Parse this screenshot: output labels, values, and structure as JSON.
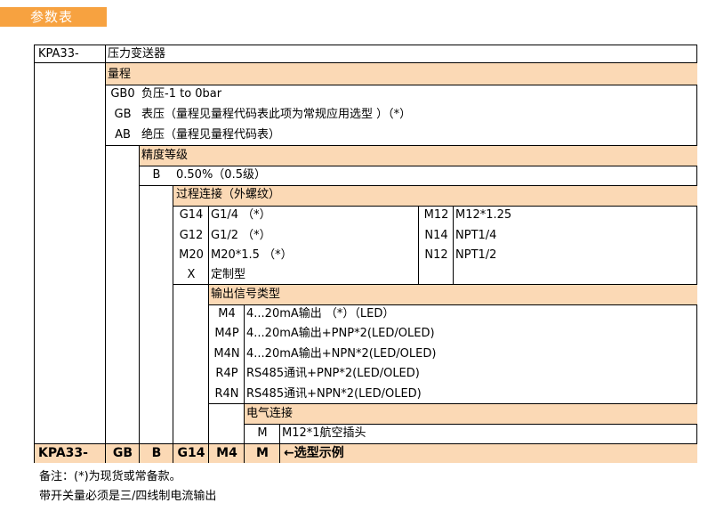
{
  "header": {
    "title": "参数表"
  },
  "table": {
    "model": "KPA33-",
    "product_name": "压力变送器",
    "range": {
      "heading": "量程",
      "options": [
        {
          "code": "GB0",
          "desc": "负压-1 to 0bar"
        },
        {
          "code": "GB",
          "desc": "表压（量程见量程代码表此项为常规应用选型 ）（*）"
        },
        {
          "code": "AB",
          "desc": "绝压（量程见量程代码表）"
        }
      ]
    },
    "accuracy": {
      "heading": "精度等级",
      "options": [
        {
          "code": "B",
          "desc": "0.50%（0.5级）"
        }
      ]
    },
    "process": {
      "heading": "过程连接（外螺纹）",
      "left": [
        {
          "code": "G14",
          "desc": "G1/4 （*）"
        },
        {
          "code": "G12",
          "desc": "G1/2 （*）"
        },
        {
          "code": "M20",
          "desc": "M20*1.5 （*）"
        },
        {
          "code": "X",
          "desc": "定制型"
        }
      ],
      "right": [
        {
          "code": "M12",
          "desc": "M12*1.25"
        },
        {
          "code": "N14",
          "desc": "NPT1/4"
        },
        {
          "code": "N12",
          "desc": "NPT1/2"
        }
      ]
    },
    "output": {
      "heading": "输出信号类型",
      "options": [
        {
          "code": "M4",
          "desc": "4...20mA输出 （*）（LED）"
        },
        {
          "code": "M4P",
          "desc": "4...20mA输出+PNP*2(LED/OLED)"
        },
        {
          "code": "M4N",
          "desc": "4...20mA输出+NPN*2(LED/OLED)"
        },
        {
          "code": "R4P",
          "desc": "RS485通讯+PNP*2(LED/OLED)"
        },
        {
          "code": "R4N",
          "desc": "RS485通讯+NPN*2(LED/OLED)"
        }
      ]
    },
    "electrical": {
      "heading": "电气连接",
      "options": [
        {
          "code": "M",
          "desc": "M12*1航空插头"
        }
      ]
    },
    "example": {
      "cells": [
        "KPA33-",
        "GB",
        "B",
        "G14",
        "M4",
        "M"
      ],
      "label": "←选型示例"
    }
  },
  "notes": [
    "备注：(*)为现货或常备款。",
    "带开关量必须是三/四线制电流输出"
  ],
  "colors": {
    "header_bg": "#f7a240",
    "section_bg": "#fbd9b5"
  }
}
